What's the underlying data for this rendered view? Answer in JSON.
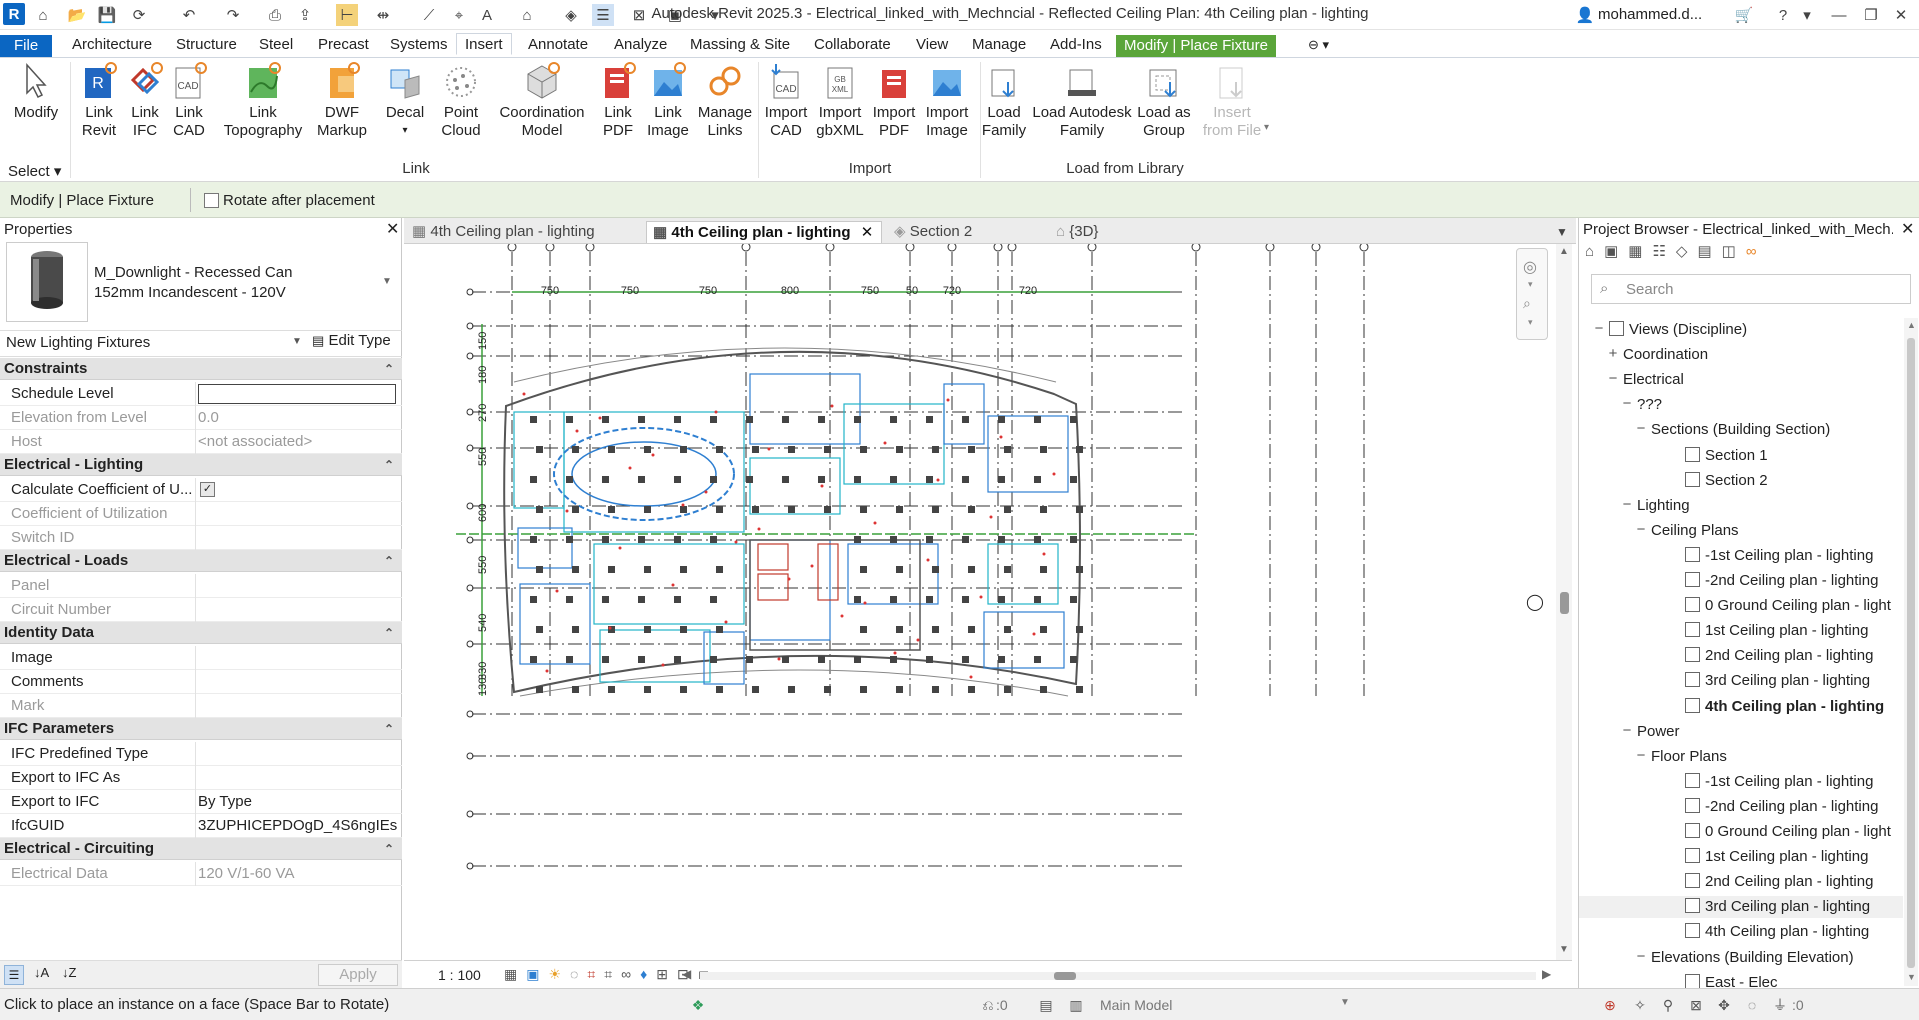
{
  "app": {
    "logo": "R",
    "title": "Autodesk Revit 2025.3 - Electrical_linked_with_Mechncial - Reflected Ceiling Plan: 4th Ceiling plan - lighting",
    "user": "mohammed.d..."
  },
  "ribbon_tabs": [
    "File",
    "Architecture",
    "Structure",
    "Steel",
    "Precast",
    "Systems",
    "Insert",
    "Annotate",
    "Analyze",
    "Massing & Site",
    "Collaborate",
    "View",
    "Manage",
    "Add-Ins",
    "Modify | Place Fixture"
  ],
  "active_tab": "Insert",
  "ribbon": {
    "modify": {
      "label": "Modify"
    },
    "select_panel": "Select",
    "link_panel": "Link",
    "import_panel": "Import",
    "library_panel": "Load from Library",
    "link_buttons": [
      {
        "l1": "Link",
        "l2": "Revit"
      },
      {
        "l1": "Link",
        "l2": "IFC"
      },
      {
        "l1": "Link",
        "l2": "CAD"
      },
      {
        "l1": "Link",
        "l2": "Topography"
      },
      {
        "l1": "DWF",
        "l2": "Markup"
      },
      {
        "l1": "Decal",
        "l2": ""
      },
      {
        "l1": "Point",
        "l2": "Cloud"
      },
      {
        "l1": "Coordination",
        "l2": "Model"
      },
      {
        "l1": "Link",
        "l2": "PDF"
      },
      {
        "l1": "Link",
        "l2": "Image"
      },
      {
        "l1": "Manage",
        "l2": "Links"
      }
    ],
    "import_buttons": [
      {
        "l1": "Import",
        "l2": "CAD"
      },
      {
        "l1": "Import",
        "l2": "gbXML"
      },
      {
        "l1": "Import",
        "l2": "PDF"
      },
      {
        "l1": "Import",
        "l2": "Image"
      }
    ],
    "library_buttons": [
      {
        "l1": "Load",
        "l2": "Family"
      },
      {
        "l1": "Load Autodesk",
        "l2": "Family"
      },
      {
        "l1": "Load as",
        "l2": "Group"
      },
      {
        "l1": "Insert",
        "l2": "from File"
      }
    ]
  },
  "options_bar": {
    "context": "Modify | Place Fixture",
    "rotate_label": "Rotate after placement",
    "rotate_checked": false
  },
  "properties": {
    "title": "Properties",
    "type_line1": "M_Downlight - Recessed Can",
    "type_line2": "152mm Incandescent - 120V",
    "category": "New Lighting Fixtures",
    "edit_type": "Edit Type",
    "sections": [
      {
        "name": "Constraints",
        "rows": [
          {
            "k": "Schedule Level",
            "v": "",
            "editable": true
          },
          {
            "k": "Elevation from Level",
            "v": "0.0",
            "dis": true
          },
          {
            "k": "Host",
            "v": "<not associated>",
            "dis": true
          }
        ]
      },
      {
        "name": "Electrical - Lighting",
        "rows": [
          {
            "k": "Calculate Coefficient of U...",
            "v": "",
            "check": true
          },
          {
            "k": "Coefficient of Utilization",
            "v": "",
            "dis": true
          },
          {
            "k": "Switch ID",
            "v": "",
            "dis": true
          }
        ]
      },
      {
        "name": "Electrical - Loads",
        "rows": [
          {
            "k": "Panel",
            "v": "",
            "dis": true
          },
          {
            "k": "Circuit Number",
            "v": "",
            "dis": true
          }
        ]
      },
      {
        "name": "Identity Data",
        "rows": [
          {
            "k": "Image",
            "v": ""
          },
          {
            "k": "Comments",
            "v": ""
          },
          {
            "k": "Mark",
            "v": "",
            "dis": true
          }
        ]
      },
      {
        "name": "IFC Parameters",
        "rows": [
          {
            "k": "IFC Predefined Type",
            "v": ""
          },
          {
            "k": "Export to IFC As",
            "v": ""
          },
          {
            "k": "Export to IFC",
            "v": "By Type"
          },
          {
            "k": "IfcGUID",
            "v": "3ZUPHICEPDOgD_4S6ngIEs"
          }
        ]
      },
      {
        "name": "Electrical - Circuiting",
        "rows": [
          {
            "k": "Electrical Data",
            "v": "120 V/1-60 VA",
            "dis": true
          }
        ]
      }
    ],
    "apply": "Apply"
  },
  "view_tabs": [
    {
      "label": "4th Ceiling plan - lighting",
      "active": false
    },
    {
      "label": "4th Ceiling plan - lighting",
      "active": true
    },
    {
      "label": "Section 2",
      "active": false
    },
    {
      "label": "{3D}",
      "active": false
    }
  ],
  "drawing": {
    "dims_top": [
      "750",
      "750",
      "750",
      "800",
      "750",
      "50",
      "720",
      "720"
    ],
    "dims_left": [
      "150",
      "180",
      "270",
      "550",
      "600",
      "550",
      "540",
      "330",
      "130"
    ]
  },
  "view_control": {
    "scale": "1 : 100"
  },
  "project_browser": {
    "title": "Project Browser - Electrical_linked_with_Mech...",
    "search_placeholder": "Search",
    "tree": [
      {
        "t": "Views (Discipline)",
        "lvl": 0,
        "tog": "−",
        "icon": true
      },
      {
        "t": "Coordination",
        "lvl": 1,
        "tog": "+"
      },
      {
        "t": "Electrical",
        "lvl": 1,
        "tog": "−"
      },
      {
        "t": "???",
        "lvl": 2,
        "tog": "−"
      },
      {
        "t": "Sections (Building Section)",
        "lvl": 3,
        "tog": "−"
      },
      {
        "t": "Section 1",
        "lvl": 4,
        "view": true
      },
      {
        "t": "Section 2",
        "lvl": 4,
        "view": true
      },
      {
        "t": "Lighting",
        "lvl": 2,
        "tog": "−"
      },
      {
        "t": "Ceiling Plans",
        "lvl": 3,
        "tog": "−"
      },
      {
        "t": "-1st Ceiling plan - lighting",
        "lvl": 4,
        "view": true
      },
      {
        "t": "-2nd Ceiling plan - lighting",
        "lvl": 4,
        "view": true
      },
      {
        "t": "0 Ground Ceiling plan - light",
        "lvl": 4,
        "view": true
      },
      {
        "t": "1st Ceiling plan - lighting",
        "lvl": 4,
        "view": true
      },
      {
        "t": "2nd Ceiling plan - lighting",
        "lvl": 4,
        "view": true
      },
      {
        "t": "3rd Ceiling plan - lighting",
        "lvl": 4,
        "view": true
      },
      {
        "t": "4th Ceiling plan - lighting",
        "lvl": 4,
        "view": true,
        "bold": true
      },
      {
        "t": "Power",
        "lvl": 2,
        "tog": "−"
      },
      {
        "t": "Floor Plans",
        "lvl": 3,
        "tog": "−"
      },
      {
        "t": "-1st Ceiling plan - lighting",
        "lvl": 4,
        "view": true
      },
      {
        "t": "-2nd Ceiling plan - lighting",
        "lvl": 4,
        "view": true
      },
      {
        "t": "0 Ground Ceiling plan - light",
        "lvl": 4,
        "view": true
      },
      {
        "t": "1st Ceiling plan - lighting",
        "lvl": 4,
        "view": true
      },
      {
        "t": "2nd Ceiling plan - lighting",
        "lvl": 4,
        "view": true
      },
      {
        "t": "3rd Ceiling plan - lighting",
        "lvl": 4,
        "view": true,
        "hl": true
      },
      {
        "t": "4th Ceiling plan - lighting",
        "lvl": 4,
        "view": true
      },
      {
        "t": "Elevations (Building Elevation)",
        "lvl": 3,
        "tog": "−"
      },
      {
        "t": "East - Elec",
        "lvl": 4,
        "view": true
      }
    ]
  },
  "status": {
    "message": "Click to place an instance on a face (Space Bar to Rotate)",
    "worksets": ":0",
    "model": "Main Model",
    "filter": ":0"
  }
}
